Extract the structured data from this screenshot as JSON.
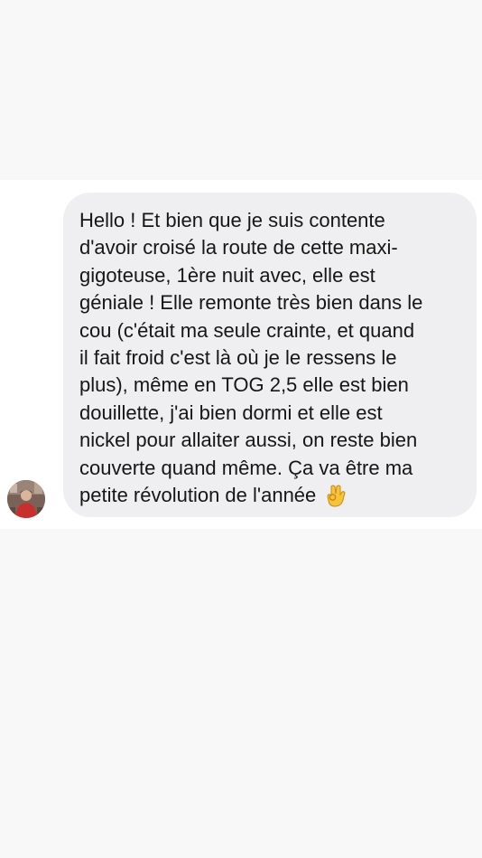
{
  "conversation": {
    "message": {
      "text": "Hello ! Et bien que je suis contente\nd'avoir croisé la route de cette maxi-\ngigoteuse, 1ère nuit avec, elle est\ngéniale ! Elle remonte très bien dans le\ncou (c'était ma seule crainte, et quand\nil fait froid c'est là où je le ressens le\nplus), même en TOG 2,5 elle est bien\ndouillette, j'ai bien dormi et elle est\nnickel pour allaiter aussi, on reste bien\ncouverte quand même. Ça va être ma\npetite révolution de l'année",
      "emoji": "ok-hand-emoji",
      "bubble_color": "#efeff1",
      "text_color": "#161616"
    },
    "sender": {
      "avatar": "avatar-photo"
    }
  }
}
